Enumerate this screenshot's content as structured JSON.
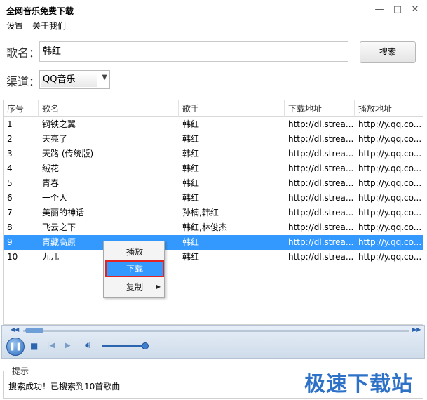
{
  "window": {
    "title": "全网音乐免费下载",
    "minimize_glyph": "—",
    "maximize_glyph": "□",
    "close_glyph": "✕"
  },
  "menu": {
    "items": [
      "设置",
      "关于我们"
    ]
  },
  "search": {
    "label": "歌名：",
    "value": "韩红",
    "button_label": "搜索"
  },
  "channel": {
    "label": "渠道：",
    "selected": "QQ音乐"
  },
  "table": {
    "columns": [
      "序号",
      "歌名",
      "歌手",
      "下载地址",
      "播放地址"
    ],
    "rows": [
      [
        "1",
        "钢铁之翼",
        "韩红",
        "http://dl.strea...",
        "http://y.qq.co..."
      ],
      [
        "2",
        "天亮了",
        "韩红",
        "http://dl.strea...",
        "http://y.qq.co..."
      ],
      [
        "3",
        "天路 (传统版)",
        "韩红",
        "http://dl.strea...",
        "http://y.qq.co..."
      ],
      [
        "4",
        "绒花",
        "韩红",
        "http://dl.strea...",
        "http://y.qq.co..."
      ],
      [
        "5",
        "青春",
        "韩红",
        "http://dl.strea...",
        "http://y.qq.co..."
      ],
      [
        "6",
        "一个人",
        "韩红",
        "http://dl.strea...",
        "http://y.qq.co..."
      ],
      [
        "7",
        "美丽的神话",
        "孙楠,韩红",
        "http://dl.strea...",
        "http://y.qq.co..."
      ],
      [
        "8",
        "飞云之下",
        "韩红,林俊杰",
        "http://dl.strea...",
        "http://y.qq.co..."
      ],
      [
        "9",
        "青藏高原",
        "韩红",
        "http://dl.strea...",
        "http://y.qq.co..."
      ],
      [
        "10",
        "九儿",
        "韩红",
        "http://dl.strea...",
        "http://y.qq.co..."
      ]
    ],
    "selected_row": "9"
  },
  "context_menu": {
    "items": [
      "播放",
      "下载",
      "复制"
    ],
    "highlighted": "下载"
  },
  "player": {
    "icons": [
      "rewind-icon",
      "fast-forward-icon",
      "pause-icon",
      "stop-icon",
      "previous-icon",
      "next-icon",
      "volume-icon"
    ],
    "seek_position": 0.02,
    "volume_level": 0.95
  },
  "tips": {
    "title": "提示",
    "message": "搜索成功！已搜索到10首歌曲"
  },
  "watermark": "极速下载站",
  "colors": {
    "selection": "#3399ff",
    "highlight_outline": "#e02424",
    "player_accent": "#2d64b0",
    "watermark": "#2e72c8"
  }
}
